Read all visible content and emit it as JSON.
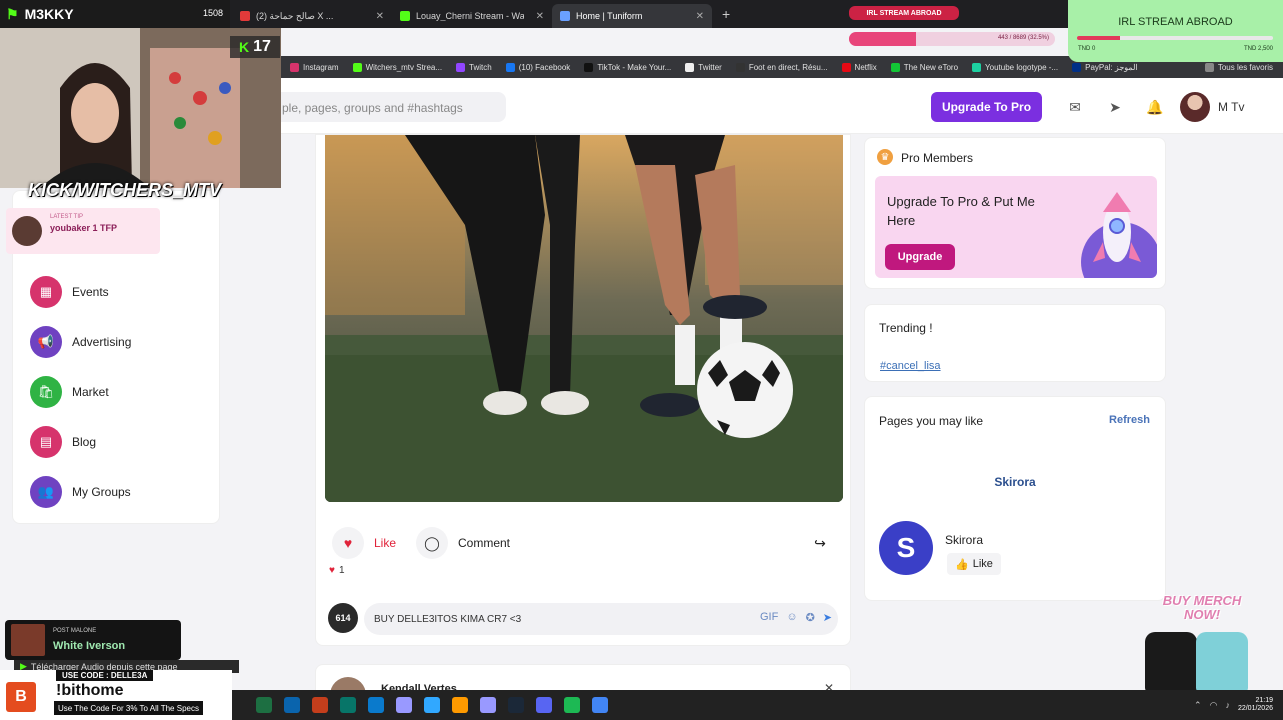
{
  "browser": {
    "tabs": [
      {
        "label": "صالح حماحة (2) X ...",
        "color": "#e23a3a",
        "active": false
      },
      {
        "label": "Louay_Cherni Stream - Wat",
        "color": "#53fc18",
        "active": false
      },
      {
        "label": "Home | Tuniform",
        "color": "#6aa0ff",
        "active": true
      }
    ],
    "new_tab": "+",
    "bookmarks": [
      {
        "label": "Instagram",
        "color": "#d6336c"
      },
      {
        "label": "Witchers_mtv Strea...",
        "color": "#53fc18"
      },
      {
        "label": "Twitch",
        "color": "#9146ff"
      },
      {
        "label": "(10) Facebook",
        "color": "#1877f2"
      },
      {
        "label": "TikTok - Make Your...",
        "color": "#111111"
      },
      {
        "label": "Twitter",
        "color": "#eeeeee"
      },
      {
        "label": "Foot en direct, Résu...",
        "color": "#333333"
      },
      {
        "label": "Netflix",
        "color": "#e50914"
      },
      {
        "label": "The New eToro",
        "color": "#13c636"
      },
      {
        "label": "Youtube logotype -...",
        "color": "#1dd1a1"
      },
      {
        "label": "PayPal: الموجز",
        "color": "#003087"
      },
      {
        "label": "Tous les favoris",
        "color": "#888888"
      }
    ]
  },
  "header": {
    "search_placeholder": "ple, pages, groups and #hashtags",
    "upgrade_label": "Upgrade To Pro",
    "user_name": "M Tv"
  },
  "sidebar": {
    "items": [
      {
        "label": "Events",
        "icon": "calendar-icon",
        "glyph": "▦",
        "color": "#d6336c"
      },
      {
        "label": "Advertising",
        "icon": "megaphone-icon",
        "glyph": "📢",
        "color": "#6f42c1"
      },
      {
        "label": "Market",
        "icon": "shopping-bag-icon",
        "glyph": "🛍",
        "color": "#2fb344"
      },
      {
        "label": "Blog",
        "icon": "document-icon",
        "glyph": "▤",
        "color": "#d6336c"
      },
      {
        "label": "My Groups",
        "icon": "group-icon",
        "glyph": "👥",
        "color": "#6f42c1"
      }
    ]
  },
  "post": {
    "like_label": "Like",
    "comment_label": "Comment",
    "like_count": "1",
    "comment_avatar_text": "614",
    "comment_value": "BUY DELLE3ITOS KIMA CR7 <3",
    "next_author": "Kendall Vertes",
    "close_glyph": "✕"
  },
  "widgets": {
    "pro_title": "Pro Members",
    "pro_text": "Upgrade To Pro & Put Me Here",
    "pro_button": "Upgrade",
    "trending_title": "Trending !",
    "trending_tag": "#cancel_lisa",
    "pages_title": "Pages you may like",
    "refresh_label": "Refresh",
    "page_name_center": "Skirora",
    "page_avatar_letter": "S",
    "page_name": "Skirora",
    "page_like_label": "Like"
  },
  "overlay": {
    "channel": "M3KKY",
    "top_count": "1508",
    "viewer_count": "17",
    "kick_brand": "KICK/WITCHERS_MTV",
    "tip_label": "LATEST TIP",
    "tip_text": "youbaker 1 TFP",
    "irl_label": "IRL STREAM ABROAD",
    "irl_progress_text": "443 / 8689 (32.5%)",
    "irl_progress": 0.325,
    "goal_title": "IRL STREAM ABROAD",
    "goal_min": "TND 0",
    "goal_max": "TND 2,500",
    "goal_progress": 0.22,
    "merch_text": "BUY MERCH NOW!",
    "song_label": "POST MALONE",
    "song_title": "White Iverson",
    "download_text": "Télécharger Audio depuis cette page",
    "promo_code": "USE CODE : DELLE3A",
    "promo_command": "!bithome",
    "promo_sub": "Use The Code For 3% To All The Specs",
    "promo_logo": "B"
  },
  "taskbar": {
    "time": "21:19",
    "date": "22/01/2026",
    "apps": [
      {
        "name": "excel-icon",
        "color": "#1d6f42"
      },
      {
        "name": "outlook-icon",
        "color": "#0a64ad"
      },
      {
        "name": "powerpoint-icon",
        "color": "#c43e1c"
      },
      {
        "name": "publisher-icon",
        "color": "#077568"
      },
      {
        "name": "vscode-icon",
        "color": "#0a7acc"
      },
      {
        "name": "after-effects-icon",
        "color": "#9999ff"
      },
      {
        "name": "photoshop-icon",
        "color": "#31a8ff"
      },
      {
        "name": "illustrator-icon",
        "color": "#ff9a00"
      },
      {
        "name": "premiere-icon",
        "color": "#9999ff"
      },
      {
        "name": "steam-icon",
        "color": "#1b2838"
      },
      {
        "name": "discord-icon",
        "color": "#5865f2"
      },
      {
        "name": "spotify-icon",
        "color": "#1db954"
      },
      {
        "name": "chrome-icon",
        "color": "#4285f4"
      }
    ]
  }
}
